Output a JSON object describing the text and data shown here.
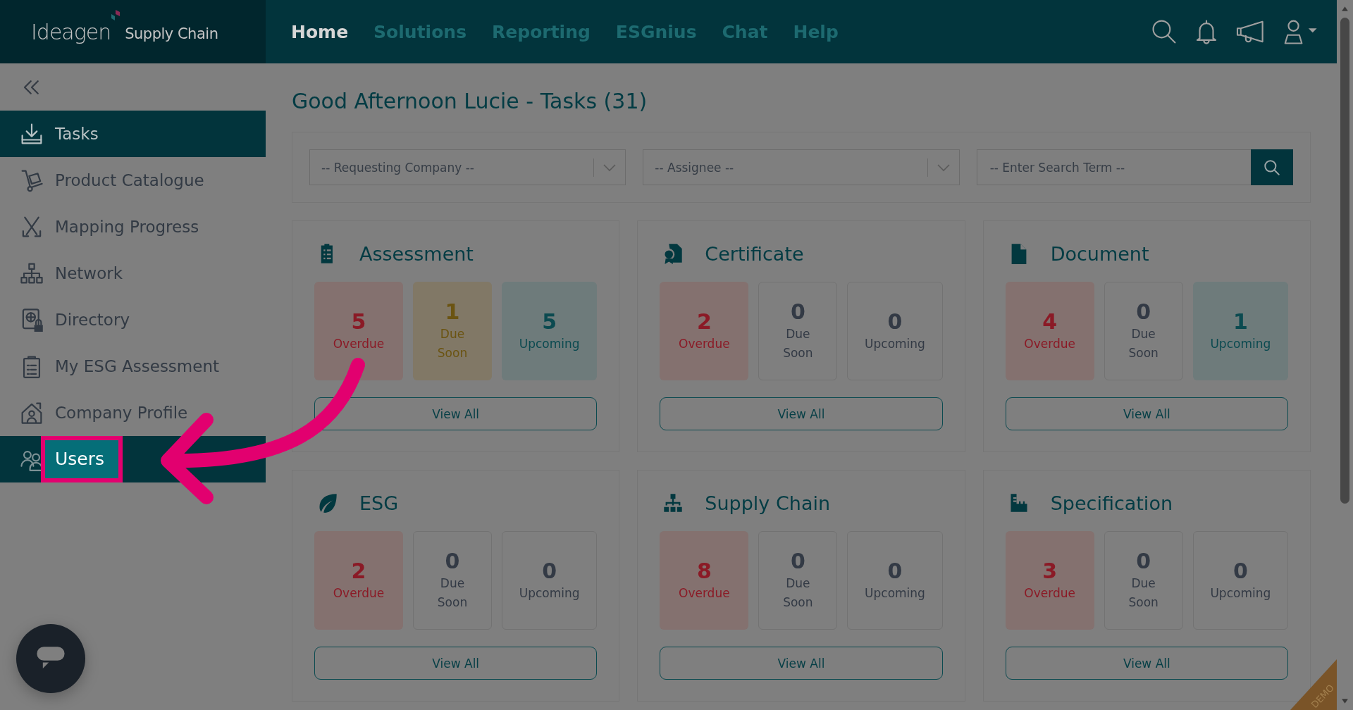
{
  "header": {
    "logo": {
      "brand": "Ideagen",
      "product": "Supply Chain"
    },
    "nav": [
      {
        "label": "Home",
        "selected": true
      },
      {
        "label": "Solutions",
        "selected": false
      },
      {
        "label": "Reporting",
        "selected": false
      },
      {
        "label": "ESGnius",
        "selected": false
      },
      {
        "label": "Chat",
        "selected": false
      },
      {
        "label": "Help",
        "selected": false
      }
    ]
  },
  "sidebar": {
    "items": [
      {
        "label": "Tasks",
        "selected": true,
        "highlighted": false
      },
      {
        "label": "Product Catalogue",
        "selected": false,
        "highlighted": false
      },
      {
        "label": "Mapping Progress",
        "selected": false,
        "highlighted": false
      },
      {
        "label": "Network",
        "selected": false,
        "highlighted": false
      },
      {
        "label": "Directory",
        "selected": false,
        "highlighted": false
      },
      {
        "label": "My ESG Assessment",
        "selected": false,
        "highlighted": false
      },
      {
        "label": "Company Profile",
        "selected": false,
        "highlighted": false
      },
      {
        "label": "Users",
        "selected": true,
        "highlighted": true
      }
    ]
  },
  "page_title": "Good Afternoon Lucie - Tasks (31)",
  "filters": {
    "dropdowns": [
      {
        "value": "-- Requesting Company --"
      },
      {
        "value": "-- Assignee --"
      }
    ],
    "search": {
      "placeholder": "-- Enter Search Term --"
    }
  },
  "cards": [
    {
      "title": "Assessment",
      "button": "View All",
      "tiles": [
        {
          "kind": "overdue",
          "count": "5",
          "label": "Overdue",
          "highlighted": true
        },
        {
          "kind": "due_soon",
          "count": "1",
          "label": "Due Soon",
          "highlighted": true
        },
        {
          "kind": "upcoming",
          "count": "5",
          "label": "Upcoming",
          "highlighted": true
        }
      ]
    },
    {
      "title": "Certificate",
      "button": "View All",
      "tiles": [
        {
          "kind": "overdue",
          "count": "2",
          "label": "Overdue",
          "highlighted": true
        },
        {
          "kind": "due_soon",
          "count": "0",
          "label": "Due Soon",
          "highlighted": false
        },
        {
          "kind": "upcoming",
          "count": "0",
          "label": "Upcoming",
          "highlighted": false
        }
      ]
    },
    {
      "title": "Document",
      "button": "View All",
      "tiles": [
        {
          "kind": "overdue",
          "count": "4",
          "label": "Overdue",
          "highlighted": true
        },
        {
          "kind": "due_soon",
          "count": "0",
          "label": "Due Soon",
          "highlighted": false
        },
        {
          "kind": "upcoming",
          "count": "1",
          "label": "Upcoming",
          "highlighted": true
        }
      ]
    },
    {
      "title": "ESG",
      "button": "View All",
      "tiles": [
        {
          "kind": "overdue",
          "count": "2",
          "label": "Overdue",
          "highlighted": true
        },
        {
          "kind": "due_soon",
          "count": "0",
          "label": "Due Soon",
          "highlighted": false
        },
        {
          "kind": "upcoming",
          "count": "0",
          "label": "Upcoming",
          "highlighted": false
        }
      ]
    },
    {
      "title": "Supply Chain",
      "button": "View All",
      "tiles": [
        {
          "kind": "overdue",
          "count": "8",
          "label": "Overdue",
          "highlighted": true
        },
        {
          "kind": "due_soon",
          "count": "0",
          "label": "Due Soon",
          "highlighted": false
        },
        {
          "kind": "upcoming",
          "count": "0",
          "label": "Upcoming",
          "highlighted": false
        }
      ]
    },
    {
      "title": "Specification",
      "button": "View All",
      "tiles": [
        {
          "kind": "overdue",
          "count": "3",
          "label": "Overdue",
          "highlighted": true
        },
        {
          "kind": "due_soon",
          "count": "0",
          "label": "Due Soon",
          "highlighted": false
        },
        {
          "kind": "upcoming",
          "count": "0",
          "label": "Upcoming",
          "highlighted": false
        }
      ]
    }
  ],
  "ribbon": "DEMO"
}
